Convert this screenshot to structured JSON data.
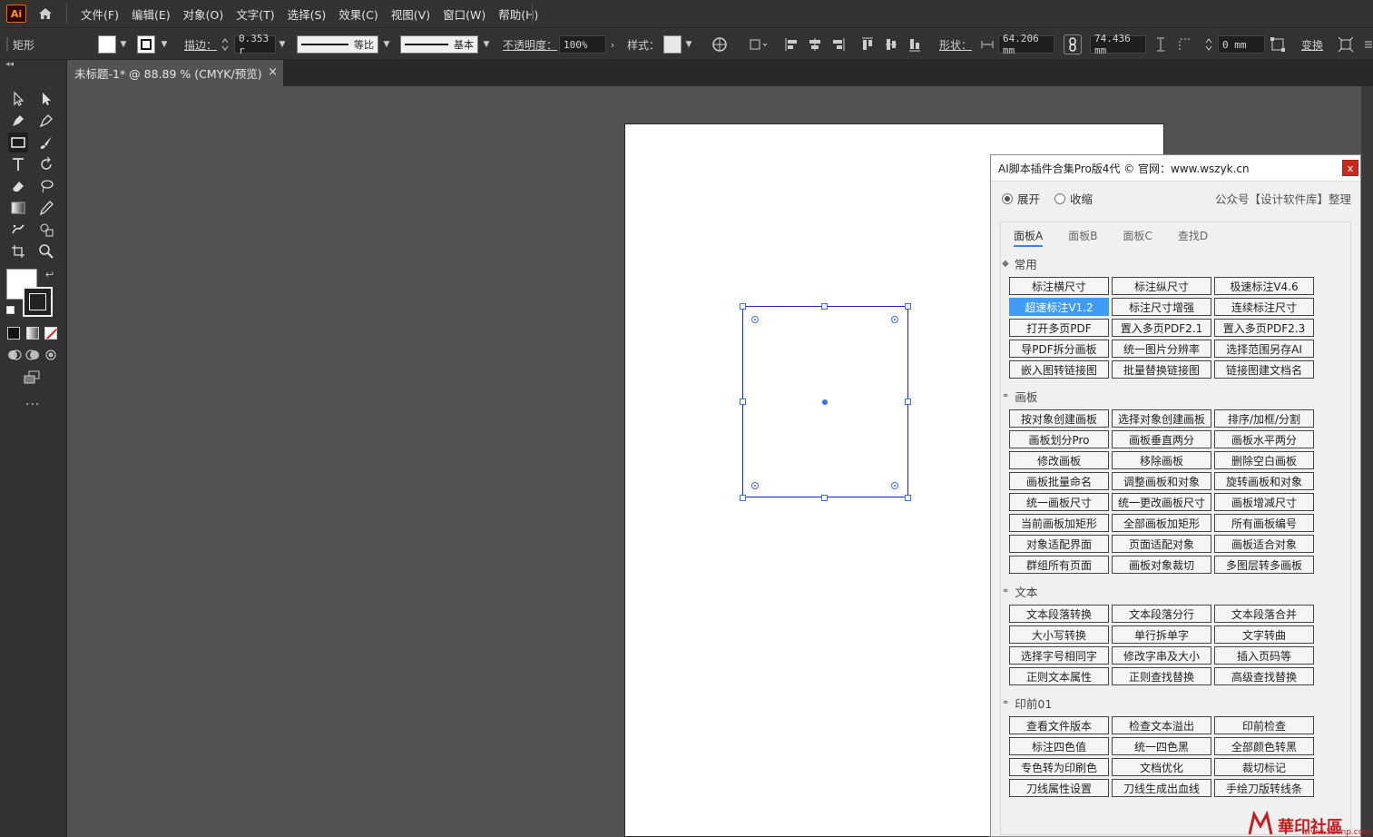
{
  "app": {
    "logo": "Ai"
  },
  "menubar": {
    "items": [
      "文件(F)",
      "编辑(E)",
      "对象(O)",
      "文字(T)",
      "选择(S)",
      "效果(C)",
      "视图(V)",
      "窗口(W)",
      "帮助(H)"
    ]
  },
  "control": {
    "tool_name": "矩形",
    "stroke_label": "描边：",
    "stroke_value": "0.353 r",
    "stroke_profile": "等比",
    "brush": "基本",
    "opacity_label": "不透明度：",
    "opacity_value": "100%",
    "style_label": "样式：",
    "shape_label": "形状：",
    "width_value": "64.206 mm",
    "height_value": "74.436 mm",
    "corner_value": "0 mm",
    "transform_label": "变换"
  },
  "document": {
    "tab_title": "未标题-1* @ 88.89 % (CMYK/预览)",
    "close": "×"
  },
  "plugin": {
    "title": "AI脚本插件合集Pro版4代 © 官网：www.wszyk.cn",
    "close": "x",
    "expand": "展开",
    "collapse": "收缩",
    "org": "公众号【设计软件库】整理",
    "tabs": [
      "面板A",
      "面板B",
      "面板C",
      "查找D"
    ],
    "sections": {
      "common": {
        "title": "常用",
        "buttons": [
          "标注横尺寸",
          "标注纵尺寸",
          "极速标注V4.6",
          "超速标注V1.2",
          "标注尺寸增强",
          "连续标注尺寸",
          "打开多页PDF",
          "置入多页PDF2.1",
          "置入多页PDF2.3",
          "导PDF拆分画板",
          "统一图片分辨率",
          "选择范围另存AI",
          "嵌入图转链接图",
          "批量替换链接图",
          "链接图建文档名"
        ]
      },
      "artboard": {
        "title": "画板",
        "buttons": [
          "按对象创建画板",
          "选择对象创建画板",
          "排序/加框/分割",
          "画板划分Pro",
          "画板垂直两分",
          "画板水平两分",
          "修改画板",
          "移除画板",
          "删除空白画板",
          "画板批量命名",
          "调整画板和对象",
          "旋转画板和对象",
          "统一画板尺寸",
          "统一更改画板尺寸",
          "画板增减尺寸",
          "当前画板加矩形",
          "全部画板加矩形",
          "所有画板编号",
          "对象适配界面",
          "页面适配对象",
          "画板适合对象",
          "群组所有页面",
          "画板对象裁切",
          "多图层转多画板"
        ]
      },
      "text": {
        "title": "文本",
        "buttons": [
          "文本段落转换",
          "文本段落分行",
          "文本段落合并",
          "大小写转换",
          "单行拆单字",
          "文字转曲",
          "选择字号相同字",
          "修改字串及大小",
          "插入页码等",
          "正则文本属性",
          "正则查找替换",
          "高级查找替换"
        ]
      },
      "prepress": {
        "title": "印前01",
        "buttons": [
          "查看文件版本",
          "检查文本溢出",
          "印前检查",
          "标注四色值",
          "统一四色黑",
          "全部颜色转黑",
          "专色转为印刷色",
          "文档优化",
          "裁切标记",
          "刀线属性设置",
          "刀线生成出血线",
          "手绘刀版转线条"
        ]
      }
    }
  },
  "watermark": {
    "text": "華印社區",
    "url": "www.52cnp.com"
  }
}
